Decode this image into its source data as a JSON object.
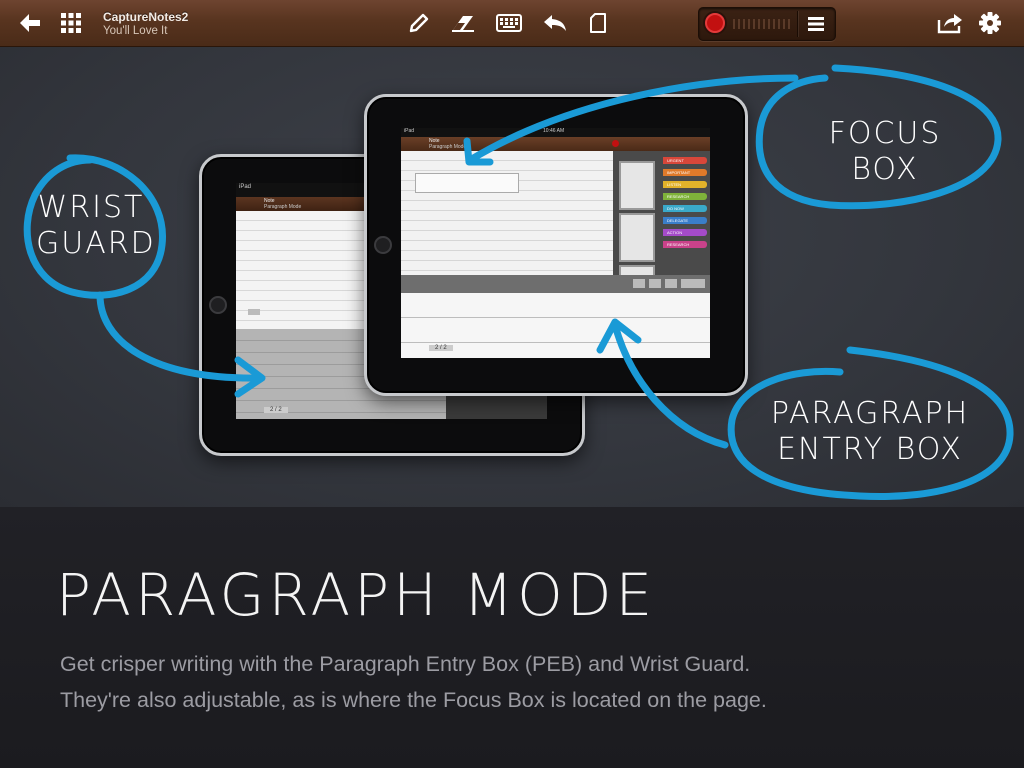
{
  "app": {
    "title": "CaptureNotes2",
    "subtitle": "You'll Love It"
  },
  "toolbar": {
    "icons": [
      "back-arrow-icon",
      "grid-icon",
      "pencil-icon",
      "eraser-icon",
      "keyboard-icon",
      "undo-icon",
      "page-icon",
      "record-icon",
      "menu-icon",
      "share-icon",
      "gear-icon"
    ]
  },
  "annotations": {
    "focus_box": "FOCUS BOX",
    "wrist_guard_line1": "WRIST",
    "wrist_guard_line2": "GUARD",
    "peb_line1": "PARAGRAPH",
    "peb_line2": "ENTRY BOX"
  },
  "mini_back": {
    "title": "Note",
    "subtitle": "Paragraph Mode",
    "carrier": "iPad",
    "page": "2 / 2"
  },
  "mini_front": {
    "title": "Note",
    "subtitle": "Paragraph Mode",
    "carrier": "iPad",
    "time": "10:46 AM",
    "page": "2 / 2",
    "tags": [
      {
        "label": "URGENT",
        "color": "#d8473a"
      },
      {
        "label": "IMPORTANT",
        "color": "#e07a2a"
      },
      {
        "label": "LISTEN",
        "color": "#e2b22a"
      },
      {
        "label": "RESEARCH",
        "color": "#7fb33a"
      },
      {
        "label": "DO NOW",
        "color": "#3aa9c9"
      },
      {
        "label": "DELEGATE",
        "color": "#3a7ec9"
      },
      {
        "label": "ACTION",
        "color": "#a54bc9"
      },
      {
        "label": "RESEARCH",
        "color": "#c9428a"
      }
    ]
  },
  "headline": "PARAGRAPH MODE",
  "description_line1": "Get crisper writing with the Paragraph Entry Box (PEB) and Wrist Guard.",
  "description_line2": "They're also adjustable, as is where the Focus Box is located on the page.",
  "colors": {
    "toolbar": "#58341f",
    "accent_blue": "#1a9ad6",
    "record_red": "#c21010",
    "background": "#33363d",
    "bottom": "#1b1b1f"
  }
}
